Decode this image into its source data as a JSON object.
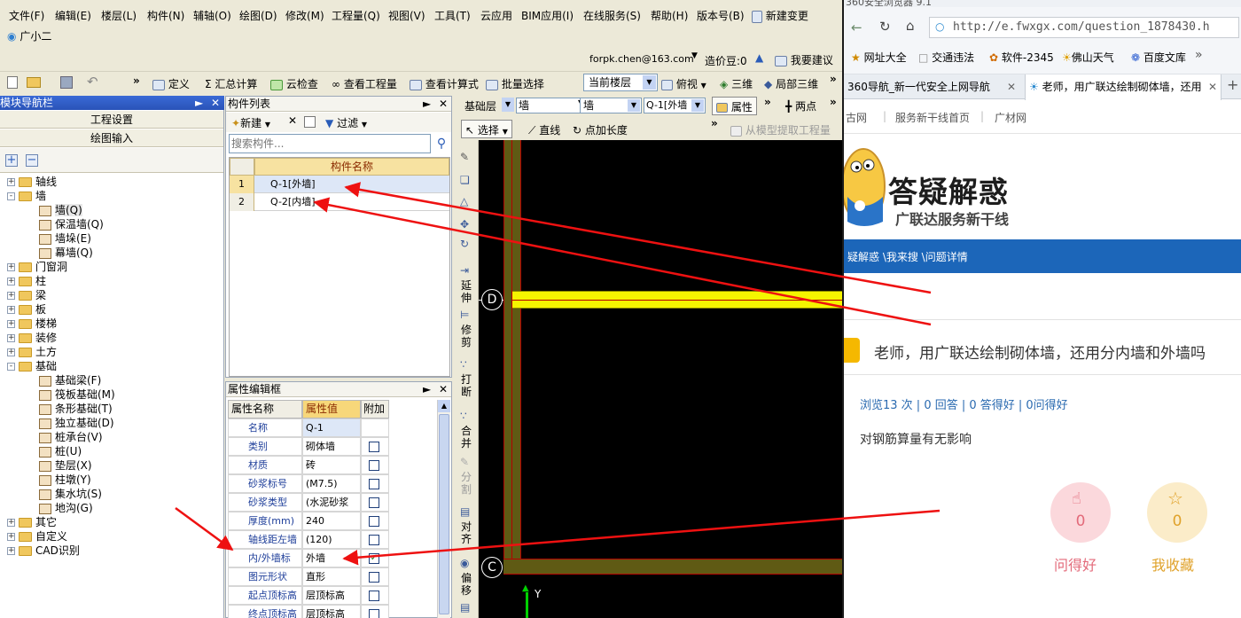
{
  "menu": [
    "文件(F)",
    "编辑(E)",
    "楼层(L)",
    "构件(N)",
    "辅轴(O)",
    "绘图(D)",
    "修改(M)",
    "工程量(Q)",
    "视图(V)",
    "工具(T)",
    "云应用",
    "BIM应用(I)",
    "在线服务(S)",
    "帮助(H)",
    "版本号(B)"
  ],
  "menu_extra": {
    "new_change": "新建变更",
    "gxe": "广小二"
  },
  "account": {
    "email": "forpk.chen@163.com",
    "price": "造价豆:0",
    "suggest": "我要建议"
  },
  "toolbar": {
    "define": "定义",
    "sum": "汇总计算",
    "cloud_check": "云检查",
    "view_qty": "查看工程量",
    "view_formula": "查看计算式",
    "batch": "批量选择",
    "floor": "当前楼层",
    "top_view": "俯视",
    "three_d": "三维",
    "local_3d": "局部三维"
  },
  "nav": {
    "title": "模块导航栏",
    "project_settings": "工程设置",
    "draw_input": "绘图输入",
    "tree": [
      {
        "label": "轴线",
        "type": "folder",
        "level": 0,
        "sign": "+"
      },
      {
        "label": "墙",
        "type": "folder",
        "level": 0,
        "sign": "-"
      },
      {
        "label": "墙(Q)",
        "type": "leaf",
        "level": 1
      },
      {
        "label": "保温墙(Q)",
        "type": "leaf",
        "level": 1
      },
      {
        "label": "墙垛(E)",
        "type": "leaf",
        "level": 1
      },
      {
        "label": "幕墙(Q)",
        "type": "leaf",
        "level": 1
      },
      {
        "label": "门窗洞",
        "type": "folder",
        "level": 0,
        "sign": "+"
      },
      {
        "label": "柱",
        "type": "folder",
        "level": 0,
        "sign": "+"
      },
      {
        "label": "梁",
        "type": "folder",
        "level": 0,
        "sign": "+"
      },
      {
        "label": "板",
        "type": "folder",
        "level": 0,
        "sign": "+"
      },
      {
        "label": "楼梯",
        "type": "folder",
        "level": 0,
        "sign": "+"
      },
      {
        "label": "装修",
        "type": "folder",
        "level": 0,
        "sign": "+"
      },
      {
        "label": "土方",
        "type": "folder",
        "level": 0,
        "sign": "+"
      },
      {
        "label": "基础",
        "type": "folder",
        "level": 0,
        "sign": "-"
      },
      {
        "label": "基础梁(F)",
        "type": "leaf",
        "level": 1
      },
      {
        "label": "筏板基础(M)",
        "type": "leaf",
        "level": 1
      },
      {
        "label": "条形基础(T)",
        "type": "leaf",
        "level": 1
      },
      {
        "label": "独立基础(D)",
        "type": "leaf",
        "level": 1
      },
      {
        "label": "桩承台(V)",
        "type": "leaf",
        "level": 1
      },
      {
        "label": "桩(U)",
        "type": "leaf",
        "level": 1
      },
      {
        "label": "垫层(X)",
        "type": "leaf",
        "level": 1
      },
      {
        "label": "柱墩(Y)",
        "type": "leaf",
        "level": 1
      },
      {
        "label": "集水坑(S)",
        "type": "leaf",
        "level": 1
      },
      {
        "label": "地沟(G)",
        "type": "leaf",
        "level": 1
      },
      {
        "label": "其它",
        "type": "folder",
        "level": 0,
        "sign": "+"
      },
      {
        "label": "自定义",
        "type": "folder",
        "level": 0,
        "sign": "+"
      },
      {
        "label": "CAD识别",
        "type": "folder",
        "level": 0,
        "sign": "+"
      }
    ]
  },
  "component_list": {
    "title": "构件列表",
    "new": "新建",
    "filter": "过滤",
    "search_placeholder": "搜索构件...",
    "header": "构件名称",
    "rows": [
      {
        "no": "1",
        "name": "Q-1[外墙]"
      },
      {
        "no": "2",
        "name": "Q-2[内墙]"
      }
    ]
  },
  "props": {
    "title": "属性编辑框",
    "col_name": "属性名称",
    "col_value": "属性值",
    "col_extra": "附加",
    "rows": [
      {
        "name": "名称",
        "value": "Q-1",
        "check": null
      },
      {
        "name": "类别",
        "value": "砌体墙",
        "check": false
      },
      {
        "name": "材质",
        "value": "砖",
        "check": false
      },
      {
        "name": "砂浆标号",
        "value": "(M7.5)",
        "check": false
      },
      {
        "name": "砂浆类型",
        "value": "(水泥砂浆",
        "check": false
      },
      {
        "name": "厚度(mm)",
        "value": "240",
        "check": false
      },
      {
        "name": "轴线距左墙",
        "value": "(120)",
        "check": false
      },
      {
        "name": "内/外墙标",
        "value": "外墙",
        "check": true
      },
      {
        "name": "图元形状",
        "value": "直形",
        "check": false
      },
      {
        "name": "起点顶标高",
        "value": "层顶标高",
        "check": false
      },
      {
        "name": "终点顶标高",
        "value": "层顶标高",
        "check": false
      }
    ]
  },
  "canvas_toolbar": {
    "layer": "基础层",
    "type1": "墙",
    "type2": "墙",
    "comp": "Q-1[外墙",
    "attr": "属性",
    "two_point": "两点",
    "select": "选择",
    "line": "直线",
    "point_len": "点加长度",
    "extract": "从模型提取工程量"
  },
  "side_tools": [
    "延伸",
    "修剪",
    "打断",
    "合并",
    "分割",
    "对齐",
    "偏移"
  ],
  "axis": {
    "d": "D",
    "c": "C",
    "y": "Y"
  },
  "browser": {
    "title": "360安全浏览器 9.1",
    "url": "http://e.fwxgx.com/question_1878430.h",
    "bookmarks": [
      "网址大全",
      "交通违法",
      "软件-2345",
      "佛山天气",
      "百度文库"
    ],
    "tabs": [
      "360导航_新一代安全上网导航",
      "老师，用广联达绘制砌体墙，还用"
    ],
    "topnav": [
      "古网",
      "服务新干线首页",
      "广材网"
    ],
    "logo_title": "答疑解惑",
    "logo_sub": "广联达服务新干线",
    "breadcrumb": "疑解惑 \\我来搜 \\问题详情",
    "question": "老师，用广联达绘制砌体墙，还用分内墙和外墙吗",
    "stats": "浏览13 次 | 0 回答 | 0 答得好 | 0问得好",
    "detail": "对钢筋算量有无影响",
    "like_count": "0",
    "like_label": "问得好",
    "fav_count": "0",
    "fav_label": "我收藏"
  }
}
